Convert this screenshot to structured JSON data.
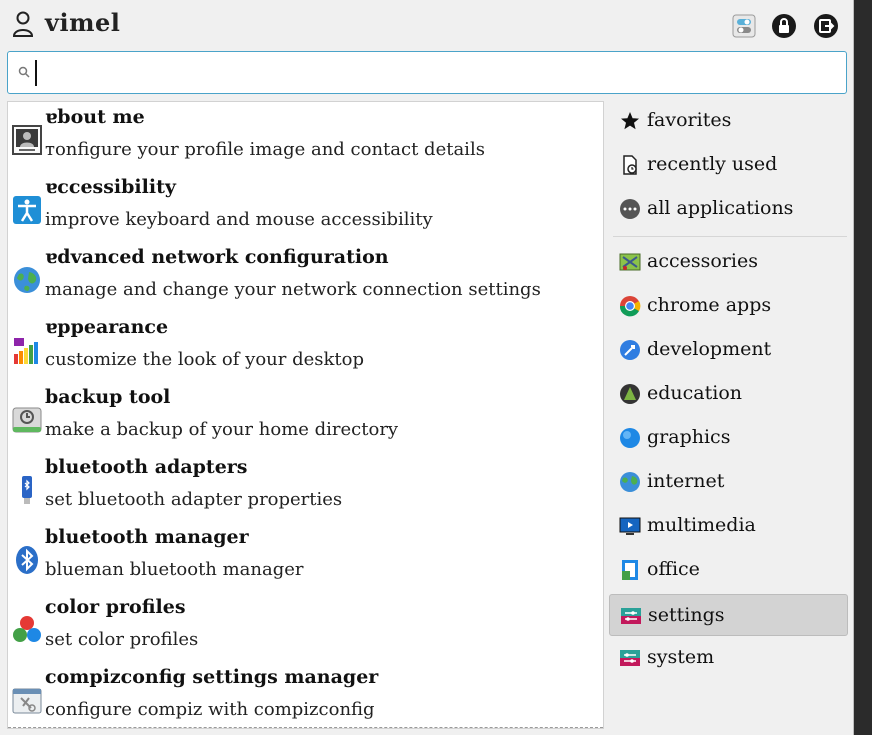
{
  "header": {
    "username": "ᴠimel"
  },
  "search": {
    "value": "",
    "placeholder": ""
  },
  "apps": [
    {
      "name": "ɐbout me",
      "description": "ᴛonfigure your profile image and contact details",
      "icon": "user-photo-icon"
    },
    {
      "name": "ɐccessibility",
      "description": "improve keyboard and mouse accessibility",
      "icon": "accessibility-icon"
    },
    {
      "name": "ɐdvanced network configuration",
      "description": "manage and change your network connection settings",
      "icon": "globe-icon"
    },
    {
      "name": "ɐppearance",
      "description": "customize the look of your desktop",
      "icon": "palette-icon"
    },
    {
      "name": "backup tool",
      "description": "make a backup of your home directory",
      "icon": "backup-drive-icon"
    },
    {
      "name": "bluetooth adapters",
      "description": "set bluetooth adapter properties",
      "icon": "usb-bluetooth-icon"
    },
    {
      "name": "bluetooth manager",
      "description": "blueman bluetooth manager",
      "icon": "bluetooth-icon"
    },
    {
      "name": "color profiles",
      "description": "set color profiles",
      "icon": "color-circles-icon"
    },
    {
      "name": "compizconfig settings manager",
      "description": "configure compiz with compizconfig",
      "icon": "compiz-icon"
    }
  ],
  "categories": [
    {
      "label": "favorites",
      "icon": "star-icon"
    },
    {
      "label": "recently used",
      "icon": "recent-doc-icon"
    },
    {
      "label": "all applications",
      "icon": "dots-icon"
    },
    {
      "label": "accessories",
      "icon": "accessories-icon"
    },
    {
      "label": "chrome apps",
      "icon": "chrome-icon"
    },
    {
      "label": "development",
      "icon": "development-icon"
    },
    {
      "label": "education",
      "icon": "education-icon"
    },
    {
      "label": "graphics",
      "icon": "graphics-icon"
    },
    {
      "label": "internet",
      "icon": "internet-icon"
    },
    {
      "label": "multimedia",
      "icon": "multimedia-icon"
    },
    {
      "label": "office",
      "icon": "office-icon"
    },
    {
      "label": "settings",
      "icon": "settings-icon"
    },
    {
      "label": "system",
      "icon": "system-icon"
    }
  ],
  "selected_category": "settings",
  "colors": {
    "search_border": "#4aa3c9",
    "selected_bg": "#d3d3d3",
    "panel_bg": "#f0f0f0"
  }
}
